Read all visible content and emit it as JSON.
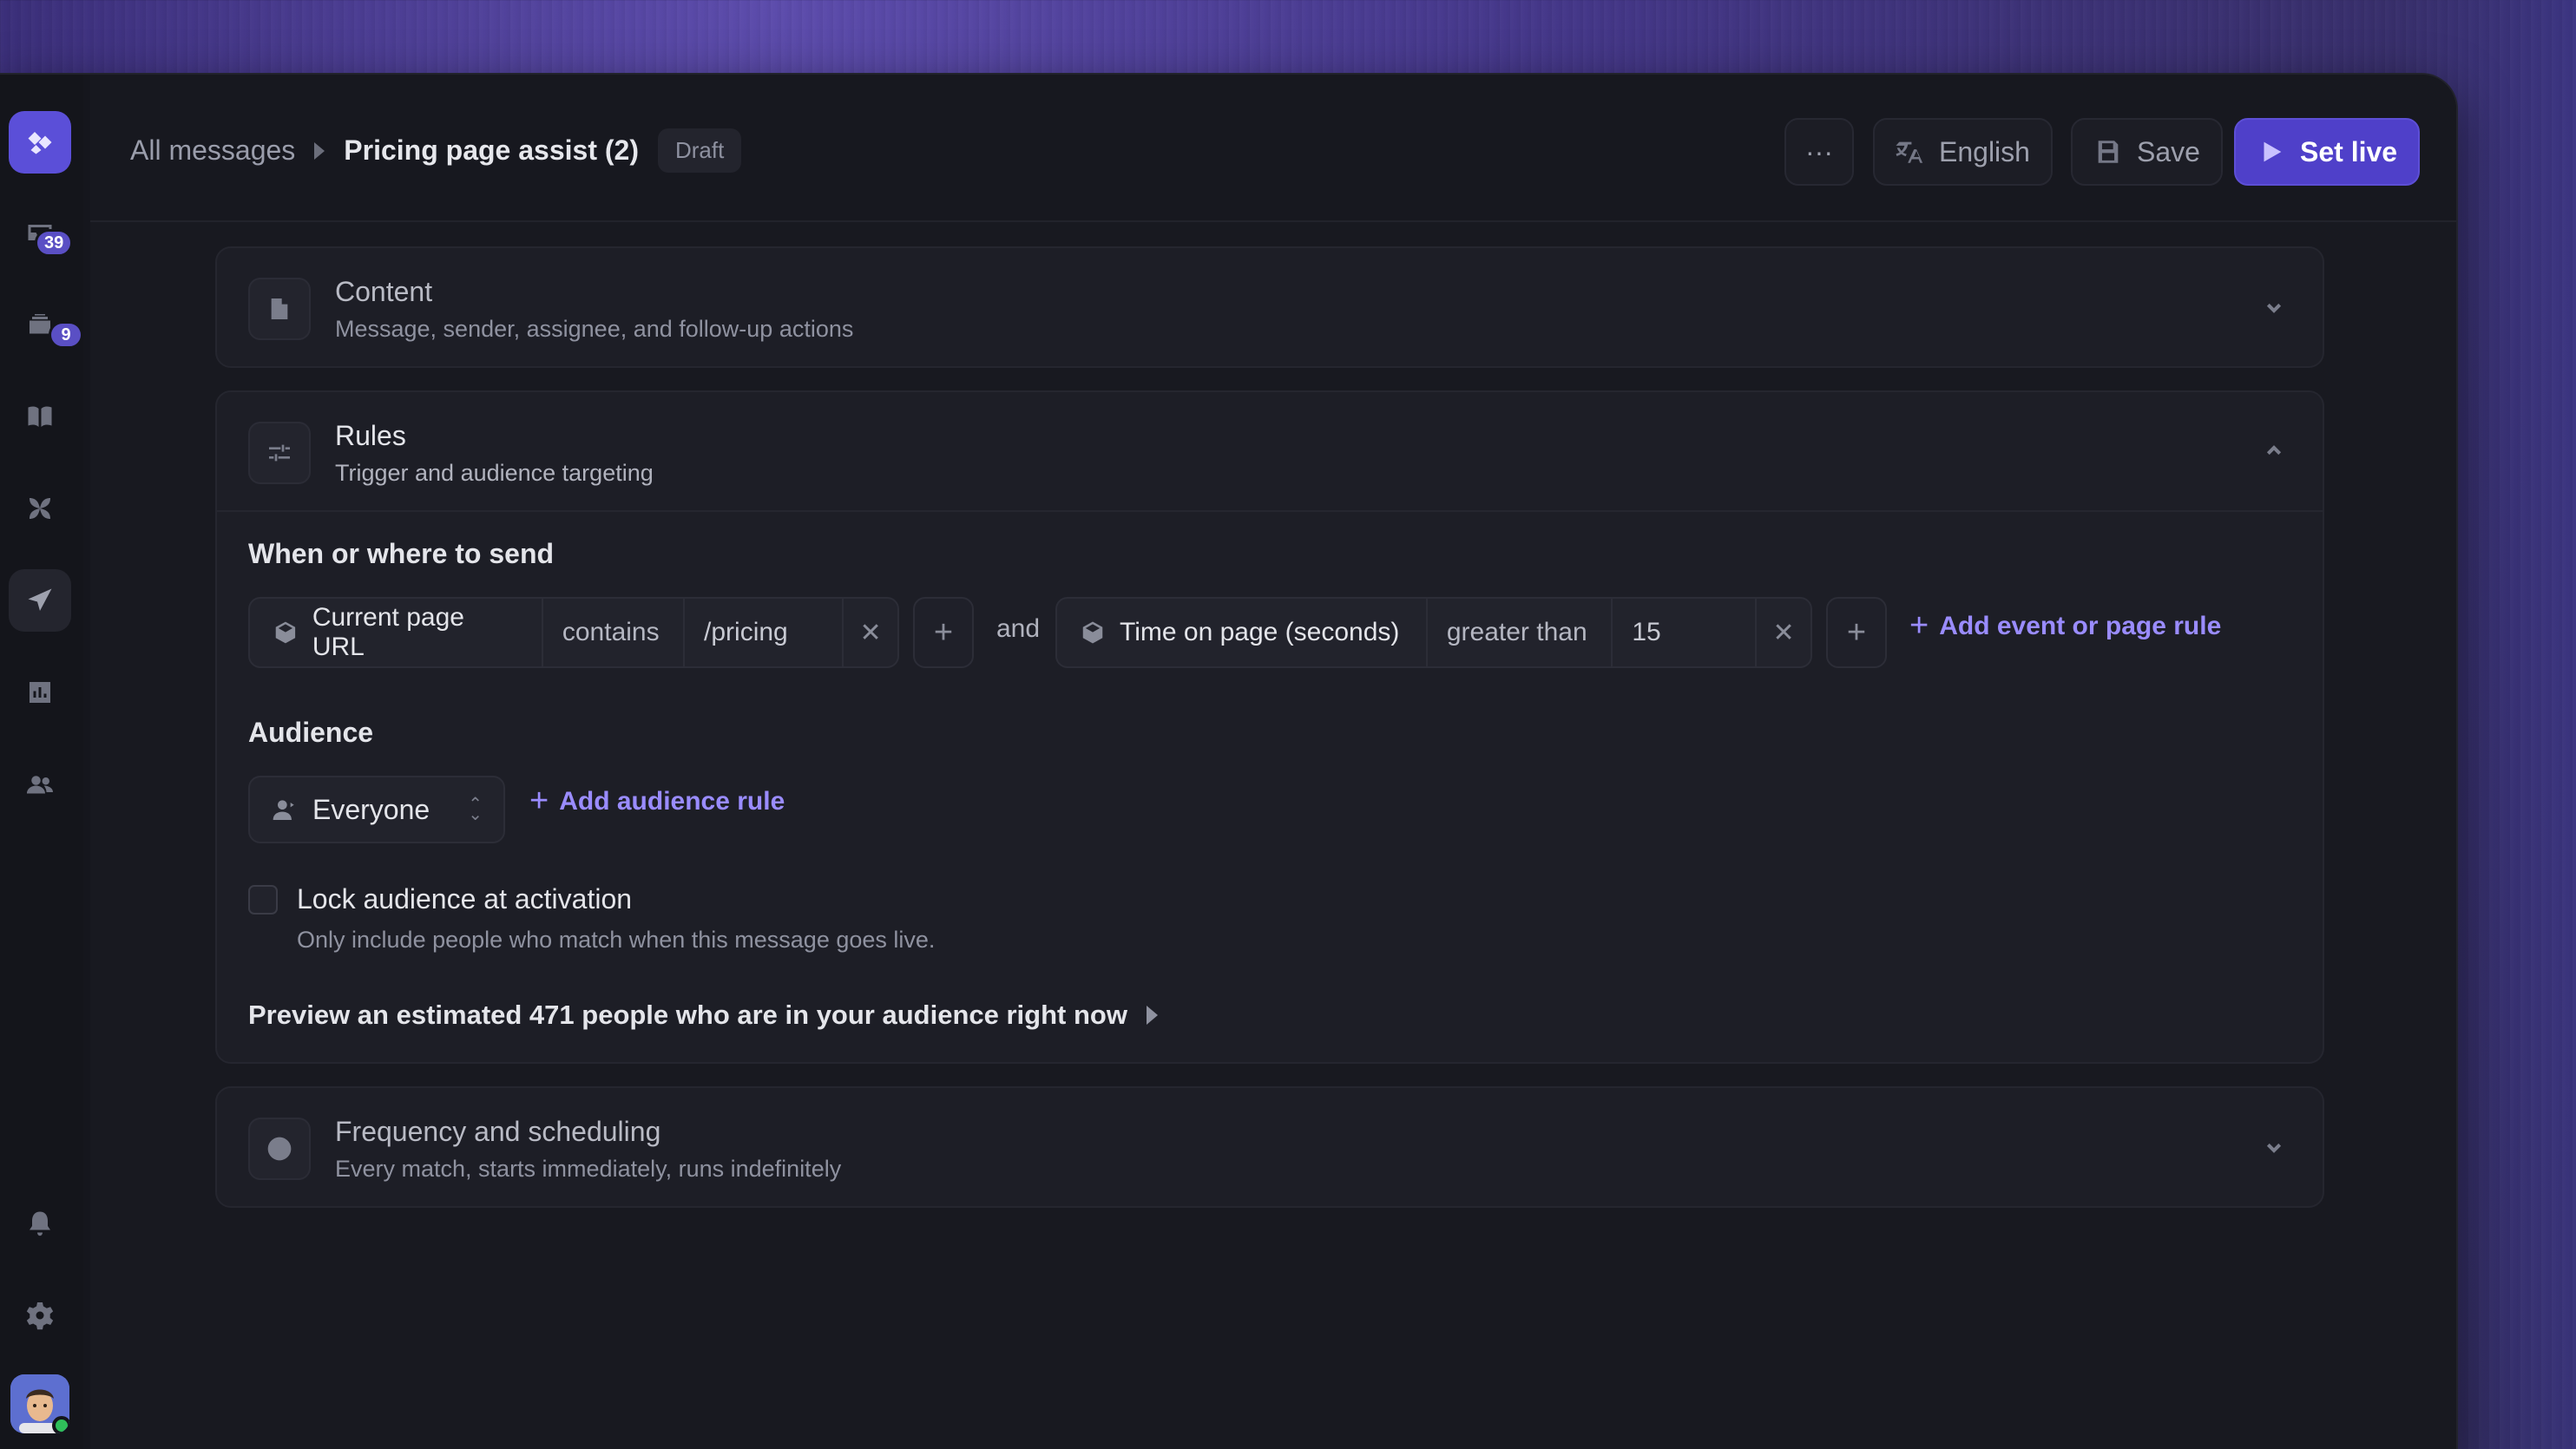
{
  "rail": {
    "badges": {
      "inbox": "39",
      "tickets": "9"
    }
  },
  "breadcrumb": {
    "root": "All messages",
    "current": "Pricing page assist (2)",
    "status": "Draft"
  },
  "toolbar": {
    "more_label": "···",
    "language_label": "English",
    "save_label": "Save",
    "set_live_label": "Set live"
  },
  "sections": {
    "content": {
      "title": "Content",
      "subtitle": "Message, sender, assignee, and follow-up actions"
    },
    "rules": {
      "title": "Rules",
      "subtitle": "Trigger and audience targeting"
    },
    "frequency": {
      "title": "Frequency and scheduling",
      "subtitle": "Every match, starts immediately, runs indefinitely"
    }
  },
  "rules": {
    "when_heading": "When or where to send",
    "conditions": [
      {
        "attribute": "Current page URL",
        "operator": "contains",
        "value": "/pricing"
      },
      {
        "attribute": "Time on page (seconds)",
        "operator": "greater than",
        "value": "15"
      }
    ],
    "joiner": "and",
    "add_rule_label": "Add event or page rule",
    "audience_heading": "Audience",
    "audience_select": "Everyone",
    "add_audience_label": "Add audience rule",
    "lock_label": "Lock audience at activation",
    "lock_hint": "Only include people who match when this message goes live.",
    "preview_text": "Preview an estimated 471 people who are in your audience right now"
  },
  "colors": {
    "accent": "#5b4fd8",
    "primary_button": "#4f40c9",
    "link": "#9a8cff",
    "online": "#2fbf5a"
  },
  "icons": {
    "rail": [
      "logo-icon",
      "inbox-icon",
      "tickets-icon",
      "book-icon",
      "fin-icon",
      "outbound-icon",
      "reports-icon",
      "contacts-icon",
      "bell-icon",
      "gear-icon"
    ]
  }
}
